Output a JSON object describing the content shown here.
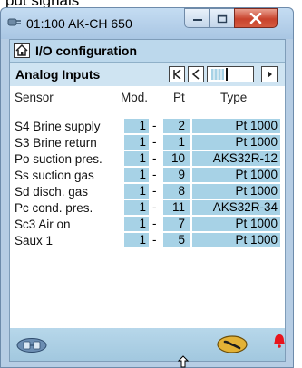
{
  "partial_top_text": "put signals",
  "window": {
    "title": "01:100 AK-CH 650"
  },
  "header": {
    "title": "I/O configuration"
  },
  "subheader": {
    "title": "Analog Inputs"
  },
  "columns": {
    "sensor": "Sensor",
    "mod": "Mod.",
    "pt": "Pt",
    "type": "Type"
  },
  "rows": [
    {
      "name": "S4 Brine supply",
      "mod": "1",
      "sep": "-",
      "pt": "2",
      "type": "Pt 1000"
    },
    {
      "name": "S3 Brine return",
      "mod": "1",
      "sep": "-",
      "pt": "1",
      "type": "Pt 1000"
    },
    {
      "name": "Po suction pres.",
      "mod": "1",
      "sep": "-",
      "pt": "10",
      "type": "AKS32R-12"
    },
    {
      "name": "Ss suction gas",
      "mod": "1",
      "sep": "-",
      "pt": "9",
      "type": "Pt 1000"
    },
    {
      "name": "Sd disch. gas",
      "mod": "1",
      "sep": "-",
      "pt": "8",
      "type": "Pt 1000"
    },
    {
      "name": "Pc cond. pres.",
      "mod": "1",
      "sep": "-",
      "pt": "11",
      "type": "AKS32R-34"
    },
    {
      "name": "Sc3 Air on",
      "mod": "1",
      "sep": "-",
      "pt": "7",
      "type": "Pt 1000"
    },
    {
      "name": "Saux 1",
      "mod": "1",
      "sep": "-",
      "pt": "5",
      "type": "Pt 1000"
    }
  ],
  "icons": {
    "app": "plug-icon",
    "home": "home-icon",
    "first": "first-page-icon",
    "prev": "prev-page-icon",
    "next": "next-page-icon",
    "footer_left": "device-link-icon",
    "footer_right": "service-tool-icon",
    "alarm": "alarm-bell-icon"
  },
  "colors": {
    "value_cell": "#a7d2e6",
    "header": "#bcd8ec",
    "alarm": "#e8141c",
    "close": "#c8432d"
  }
}
